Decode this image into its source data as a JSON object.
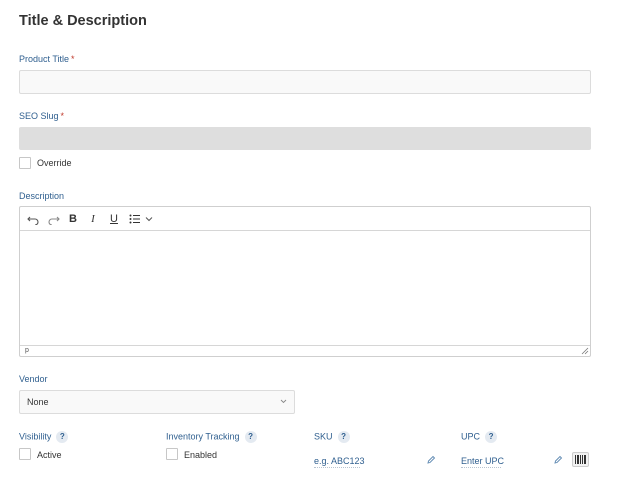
{
  "section": {
    "title": "Title & Description"
  },
  "product_title": {
    "label": "Product Title",
    "required_mark": "*",
    "value": ""
  },
  "seo_slug": {
    "label": "SEO Slug",
    "required_mark": "*",
    "value": "",
    "override_label": "Override"
  },
  "description": {
    "label": "Description",
    "toolbar": {
      "undo_icon": "undo-icon",
      "redo_icon": "redo-icon",
      "bold": "B",
      "italic": "I",
      "underline": "U",
      "list_icon": "bullet-list-icon"
    },
    "status_path": "p"
  },
  "vendor": {
    "label": "Vendor",
    "value": "None"
  },
  "visibility": {
    "label": "Visibility",
    "help": "?",
    "checkbox_label": "Active"
  },
  "inventory_tracking": {
    "label": "Inventory Tracking",
    "help": "?",
    "checkbox_label": "Enabled"
  },
  "sku": {
    "label": "SKU",
    "help": "?",
    "placeholder": "e.g. ABC123"
  },
  "upc": {
    "label": "UPC",
    "help": "?",
    "placeholder": "Enter UPC"
  },
  "colors": {
    "label": "#2f5f8f",
    "required": "#c0392b",
    "disabled_field": "#dedede"
  }
}
